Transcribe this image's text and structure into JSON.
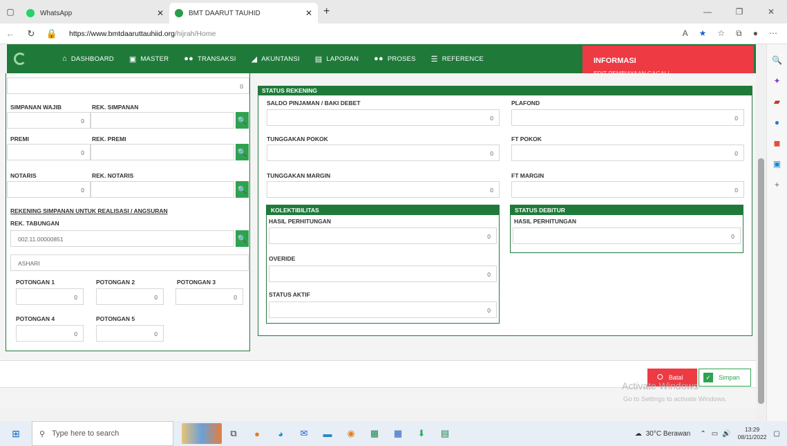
{
  "browser": {
    "tabs": [
      {
        "title": "WhatsApp"
      },
      {
        "title": "BMT DAARUT TAUHID"
      }
    ],
    "url_domain": "https://www.bmtdaaruttauhiid.org",
    "url_path": "/hijrah/Home"
  },
  "nav": {
    "items": [
      {
        "label": "DASHBOARD",
        "icon": "home-icon"
      },
      {
        "label": "MASTER",
        "icon": "briefcase-icon"
      },
      {
        "label": "TRANSAKSI",
        "icon": "group-icon"
      },
      {
        "label": "AKUNTANSI",
        "icon": "chart-icon"
      },
      {
        "label": "LAPORAN",
        "icon": "document-icon"
      },
      {
        "label": "PROSES",
        "icon": "group-icon"
      },
      {
        "label": "REFERENCE",
        "icon": "list-icon"
      }
    ]
  },
  "info": {
    "title": "INFORMASI",
    "message": "EDIT PEMBIAYAAN GAGAL!"
  },
  "left": {
    "top_value": "0",
    "simpanan_wajib_label": "SIMPANAN WAJIB",
    "simpanan_wajib_value": "0",
    "rek_simpanan_label": "REK. SIMPANAN",
    "premi_label": "PREMI",
    "premi_value": "0",
    "rek_premi_label": "REK. PREMI",
    "notaris_label": "NOTARIS",
    "notaris_value": "0",
    "rek_notaris_label": "REK. NOTARIS",
    "rekening_heading": "REKENING SIMPANAN UNTUK REALISASI / ANGSURAN",
    "rek_tabungan_label": "REK. TABUNGAN",
    "rek_tabungan_value": "002.11.00000851",
    "nama_value": "ASHARI",
    "potongan1_label": "POTONGAN 1",
    "potongan1_value": "0",
    "potongan2_label": "POTONGAN 2",
    "potongan2_value": "0",
    "potongan3_label": "POTONGAN 3",
    "potongan3_value": "0",
    "potongan4_label": "POTONGAN 4",
    "potongan4_value": "0",
    "potongan5_label": "POTONGAN 5",
    "potongan5_value": "0"
  },
  "status_rekening": {
    "heading": "STATUS REKENING",
    "saldo_label": "SALDO PINJAMAN / BAKI DEBET",
    "saldo_value": "0",
    "plafond_label": "PLAFOND",
    "plafond_value": "0",
    "tunggakan_pokok_label": "TUNGGAKAN POKOK",
    "tunggakan_pokok_value": "0",
    "ft_pokok_label": "FT POKOK",
    "ft_pokok_value": "0",
    "tunggakan_margin_label": "TUNGGAKAN MARGIN",
    "tunggakan_margin_value": "0",
    "ft_margin_label": "FT MARGIN",
    "ft_margin_value": "0"
  },
  "kolektibilitas": {
    "heading": "KOLEKTIBILITAS",
    "hasil_label": "HASIL PERHITUNGAN",
    "hasil_value": "0",
    "overide_label": "OVERIDE",
    "overide_value": "0",
    "status_aktif_label": "STATUS AKTIF",
    "status_aktif_value": "0"
  },
  "status_debitur": {
    "heading": "STATUS DEBITUR",
    "hasil_label": "HASIL PERHITUNGAN",
    "hasil_value": "0"
  },
  "actions": {
    "batal": "Batal",
    "simpan": "Simpan"
  },
  "watermark": {
    "line1": "Activate Windows",
    "line2": "Go to Settings to activate Windows."
  },
  "taskbar": {
    "search_placeholder": "Type here to search",
    "weather": "30°C Berawan",
    "time": "13:29",
    "date": "08/11/2022"
  }
}
